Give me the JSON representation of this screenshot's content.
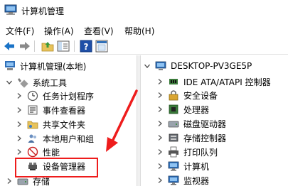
{
  "window": {
    "title": "计算机管理"
  },
  "menu": [
    "文件(F)",
    "操作(A)",
    "查看(V)",
    "帮助(H)"
  ],
  "left_tree": {
    "root": "计算机管理(本地)",
    "system_tools": "系统工具",
    "items": [
      "任务计划程序",
      "事件查看器",
      "共享文件夹",
      "本地用户和组",
      "性能",
      "设备管理器"
    ],
    "storage": "存储"
  },
  "right_tree": {
    "computer": "DESKTOP-PV3GE5P",
    "items": [
      "IDE ATA/ATAPI 控制器",
      "安全设备",
      "处理器",
      "磁盘驱动器",
      "存储控制器",
      "打印队列",
      "计算机",
      "监视器"
    ]
  },
  "colors": {
    "accent": "#1a73c7",
    "annotation": "#ee1c1c"
  },
  "icons": {
    "app": "computer-management-icon",
    "toolbar": [
      "back-arrow-icon",
      "forward-arrow-icon",
      "up-folder-icon",
      "show-hide-tree-icon",
      "help-icon",
      "properties-icon"
    ]
  }
}
